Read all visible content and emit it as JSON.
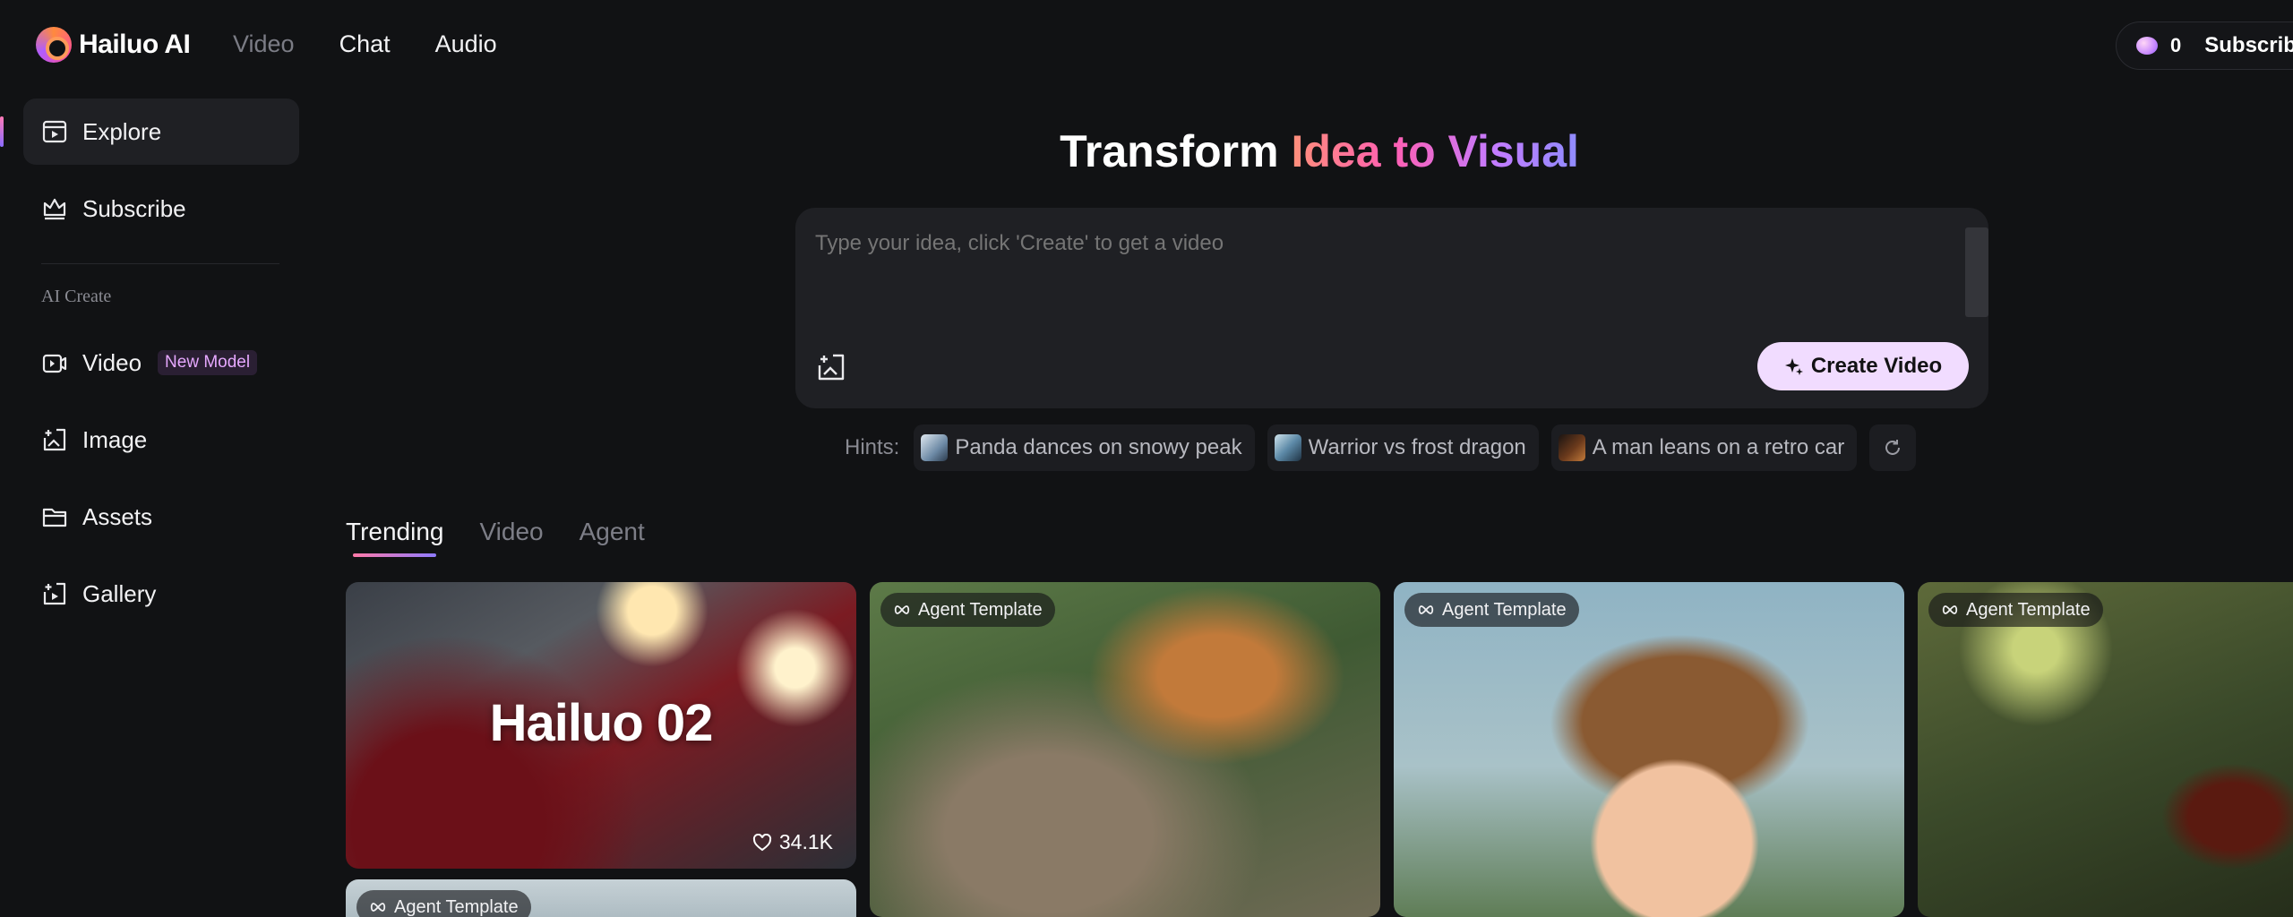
{
  "brand": {
    "name": "Hailuo AI"
  },
  "topnav": {
    "items": [
      "Video",
      "Chat",
      "Audio"
    ]
  },
  "account": {
    "credits": "0",
    "subscribe_label": "Subscribe"
  },
  "sidebar": {
    "items": [
      {
        "label": "Explore"
      },
      {
        "label": "Subscribe"
      }
    ],
    "section_label": "AI Create",
    "create_items": [
      {
        "label": "Video",
        "badge": "New Model"
      },
      {
        "label": "Image"
      },
      {
        "label": "Assets"
      },
      {
        "label": "Gallery"
      }
    ]
  },
  "hero": {
    "title_plain": "Transform",
    "title_gradient": "Idea to Visual"
  },
  "prompt": {
    "placeholder": "Type your idea, click 'Create' to get a video",
    "create_label": "Create Video"
  },
  "hints": {
    "label": "Hints:",
    "items": [
      "Panda dances on snowy peak",
      "Warrior vs frost dragon",
      "A man leans on a retro car"
    ]
  },
  "tabs": [
    "Trending",
    "Video",
    "Agent"
  ],
  "gallery": {
    "featured_title": "Hailuo 02",
    "featured_likes": "34.1K",
    "agent_tag": "Agent Template"
  },
  "colors": {
    "background": "#111214",
    "accent_pink": "#ff5fb2",
    "accent_purple": "#8f8cff",
    "create_button": "#f1dcff"
  }
}
